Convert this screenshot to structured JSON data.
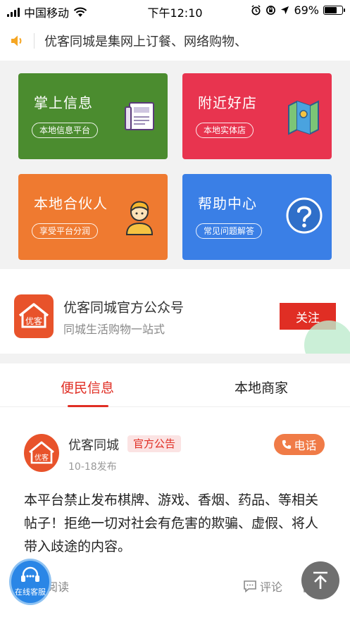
{
  "status_bar": {
    "carrier": "中国移动",
    "time": "下午12:10",
    "battery": "69%",
    "battery_level": 0.69
  },
  "notice": {
    "icon": "speaker-icon",
    "text": "优客同城是集网上订餐、网络购物、"
  },
  "grid": {
    "cards": [
      {
        "title": "掌上信息",
        "tag": "本地信息平台",
        "icon": "newspaper-icon",
        "color": "#4b8c2f"
      },
      {
        "title": "附近好店",
        "tag": "本地实体店",
        "icon": "map-icon",
        "color": "#e8344f"
      },
      {
        "title": "本地合伙人",
        "tag": "享受平台分润",
        "icon": "partner-avatar-icon",
        "color": "#ef7a30"
      },
      {
        "title": "帮助中心",
        "tag": "常见问题解答",
        "icon": "question-icon",
        "color": "#3a7fe6"
      }
    ]
  },
  "official_account": {
    "name": "优客同城官方公众号",
    "desc": "同城生活购物一站式",
    "logo_text": "优客",
    "follow_label": "关注"
  },
  "tabs": [
    {
      "label": "便民信息",
      "active": true
    },
    {
      "label": "本地商家",
      "active": false
    }
  ],
  "post": {
    "author": "优客同城",
    "badge": "官方公告",
    "date": "10-18发布",
    "call_label": "电话",
    "content": "本平台禁止发布棋牌、游戏、香烟、药品、等相关帖子！拒绝一切对社会有危害的欺骗、虚假、将人带入歧途的内容。",
    "read_label": "阅读",
    "comment_label": "评论"
  },
  "floating": {
    "service_label": "在线客服"
  },
  "colors": {
    "accent": "#e02e24",
    "call": "#f07b47"
  }
}
